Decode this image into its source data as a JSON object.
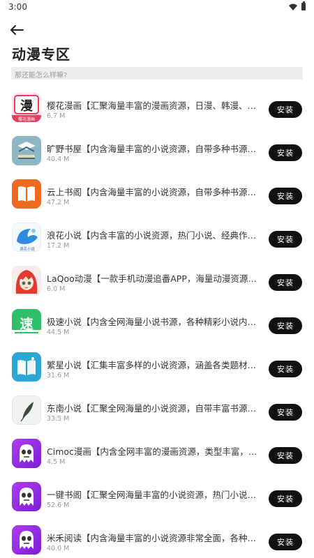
{
  "status_bar": {
    "time": "3:00"
  },
  "page": {
    "title": "动漫专区",
    "search_placeholder": "那还能怎么样嘛?"
  },
  "install_label": "安装",
  "apps": [
    {
      "name": "樱花漫画【汇聚海量丰富的漫画资源，日漫、韩漫、国漫等",
      "size": "6.7 M",
      "icon": "manga-icon"
    },
    {
      "name": "旷野书屋【内含海量丰富的小说资源，自带多种书源，精品小说",
      "size": "40.4 M",
      "icon": "book-icon"
    },
    {
      "name": "云上书阁【内含海量丰富的小说资源，自带多种书源，精品小说",
      "size": "47.2 M",
      "icon": "open-book-icon"
    },
    {
      "name": "浪花小说【内含丰富的小说资源，热门小说、经典作品应有尽有",
      "size": "17.2 M",
      "icon": "wave-icon"
    },
    {
      "name": "LaQoo动漫【一款手机动漫追番APP，海量动漫资源，每日更新",
      "size": "6.0 M",
      "icon": "anime-girl-icon"
    },
    {
      "name": "极速小说【内含全网海量小说书源，各种精彩小说内容应有尽有",
      "size": "44.5 M",
      "icon": "speed-icon"
    },
    {
      "name": "繁星小说【汇集丰富多样的小说资源，涵盖各类题材和风格",
      "size": "31.6 M",
      "icon": "book-star-icon"
    },
    {
      "name": "东南小说【汇聚全网海量的小说资源，自带丰富书源，免费阅读",
      "size": "33.5 M",
      "icon": "feather-icon"
    },
    {
      "name": "Cimoc漫画【内含全网丰富的漫画资源，类型丰富，解锁全部",
      "size": "4.5 M",
      "icon": "ghost-icon"
    },
    {
      "name": "一键书阁【汇聚全网海量丰富的小说资源，热门小说、经典名著",
      "size": "52.6 M",
      "icon": "ghost-icon"
    },
    {
      "name": "米禾阅读【内含海量丰富的小说资源非常全面，各种题材应有尽有",
      "size": "40.0 M",
      "icon": "ghost-icon"
    }
  ],
  "icon_texts": {
    "manga_char": "漫",
    "manga_caption": "樱花漫画",
    "speed_char": "速",
    "wave_caption": "浪花小说"
  }
}
